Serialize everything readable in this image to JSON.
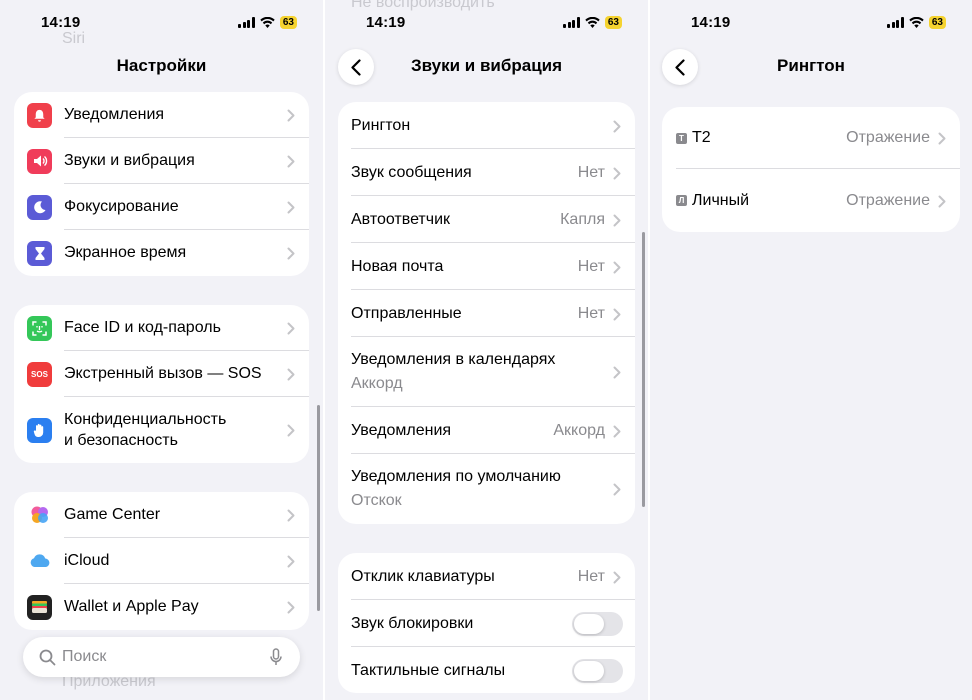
{
  "status": {
    "time": "14:19",
    "battery": "63"
  },
  "panel1": {
    "title": "Настройки",
    "ghost_top": "Siri",
    "ghost_bottom": "Приложения",
    "group1": [
      {
        "label": "Уведомления",
        "icon": "bell-icon",
        "color": "#f0404b"
      },
      {
        "label": "Звуки и вибрация",
        "icon": "speaker-icon",
        "color": "#f03c5a"
      },
      {
        "label": "Фокусирование",
        "icon": "moon-icon",
        "color": "#5b5bd6"
      },
      {
        "label": "Экранное время",
        "icon": "hourglass-icon",
        "color": "#5b5bd6"
      }
    ],
    "group2": [
      {
        "label": "Face ID и код-пароль",
        "icon": "faceid-icon",
        "color": "#34c759"
      },
      {
        "label": "Экстренный вызов — SOS",
        "icon": "sos-icon",
        "color": "#f03c3c",
        "badge": "SOS"
      },
      {
        "label1": "Конфиденциальность",
        "label2": "и безопасность",
        "icon": "hand-icon",
        "color": "#2b7ff0"
      }
    ],
    "group3": [
      {
        "label": "Game Center",
        "icon": "game-center-icon"
      },
      {
        "label": "iCloud",
        "icon": "cloud-icon"
      },
      {
        "label": "Wallet и Apple Pay",
        "icon": "wallet-icon"
      }
    ],
    "search_placeholder": "Поиск"
  },
  "panel2": {
    "title": "Звуки и вибрация",
    "ghost_top1": "Не воспроизводить",
    "group1": [
      {
        "label": "Рингтон",
        "value": ""
      },
      {
        "label": "Звук сообщения",
        "value": "Нет"
      },
      {
        "label": "Автоответчик",
        "value": "Капля"
      },
      {
        "label": "Новая почта",
        "value": "Нет"
      },
      {
        "label": "Отправленные",
        "value": "Нет"
      },
      {
        "label": "Уведомления в календарях",
        "sub": "Аккорд"
      },
      {
        "label": "Уведомления",
        "value": "Аккорд"
      },
      {
        "label": "Уведомления по умолчанию",
        "sub": "Отскок"
      }
    ],
    "group2": [
      {
        "label": "Отклик клавиатуры",
        "value": "Нет"
      },
      {
        "label": "Звук блокировки",
        "toggle": false
      },
      {
        "label": "Тактильные сигналы",
        "toggle": false
      }
    ]
  },
  "panel3": {
    "title": "Рингтон",
    "rows": [
      {
        "badge": "T",
        "label": "T2",
        "value": "Отражение"
      },
      {
        "badge": "Л",
        "label": "Личный",
        "value": "Отражение"
      }
    ]
  }
}
